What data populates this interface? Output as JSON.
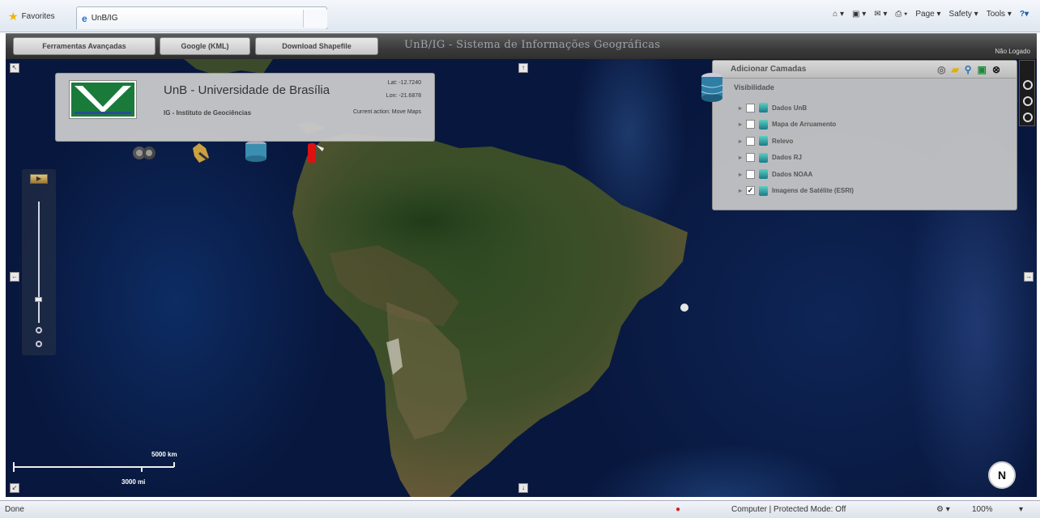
{
  "browser": {
    "favorites_label": "Favorites",
    "tab_title": "UnB/IG",
    "menu": {
      "page": "Page ▾",
      "safety": "Safety ▾",
      "tools": "Tools ▾"
    }
  },
  "toolbar": {
    "advanced_tools": "Ferramentas Avançadas",
    "google_kml": "Google (KML)",
    "download_shapefile": "Download Shapefile",
    "title": "UnB/IG - Sistema de Informações Geográficas",
    "logout": "Não Logado"
  },
  "info_panel": {
    "title": "UnB - Universidade de Brasília",
    "subtitle": "IG - Instituto de Geociências",
    "lat": "Lat: -12.7240",
    "lon": "Lon: -21.6878",
    "current_action": "Current action: Move Maps"
  },
  "layers": {
    "header": "Adicionar Camadas",
    "visibility_label": "Visibilidade",
    "items": [
      {
        "label": "Dados UnB",
        "checked": false
      },
      {
        "label": "Mapa de Arruamento",
        "checked": false
      },
      {
        "label": "Relevo",
        "checked": false
      },
      {
        "label": "Dados RJ",
        "checked": false
      },
      {
        "label": "Dados NOAA",
        "checked": false
      },
      {
        "label": "Imagens de Satélite (ESRI)",
        "checked": true
      }
    ]
  },
  "scale": {
    "top_label": "5000 km",
    "bottom_label": "3000 mi"
  },
  "compass": "N",
  "status_bar": {
    "left": "Done",
    "zone": "Computer | Protected Mode: Off",
    "zoom": "100%"
  }
}
